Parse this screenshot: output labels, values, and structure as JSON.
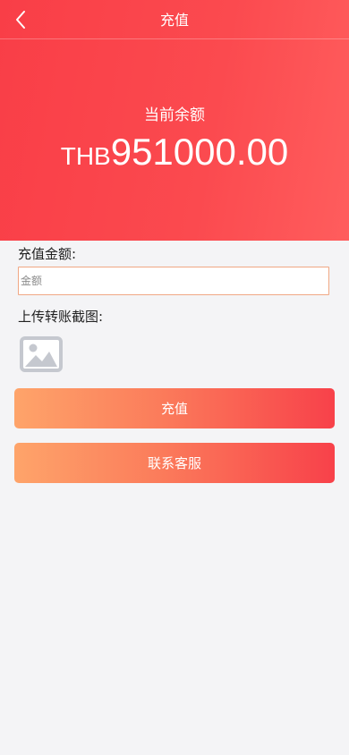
{
  "nav": {
    "title": "充值",
    "back_icon": "chevron-left-icon"
  },
  "balance": {
    "label": "当前余额",
    "currency": "THB",
    "amount": "951000.00"
  },
  "form": {
    "amount_label": "充值金额:",
    "amount_placeholder": "金额",
    "amount_value": "",
    "upload_label": "上传转账截图:",
    "upload_icon": "image-placeholder-icon"
  },
  "buttons": {
    "recharge": "充值",
    "contact": "联系客服"
  },
  "colors": {
    "hero_start": "#f93e47",
    "hero_end": "#ff5d5d",
    "button_start": "#fea46a",
    "button_end": "#f8414a",
    "input_border": "#f0a784",
    "background": "#f4f4f6"
  }
}
